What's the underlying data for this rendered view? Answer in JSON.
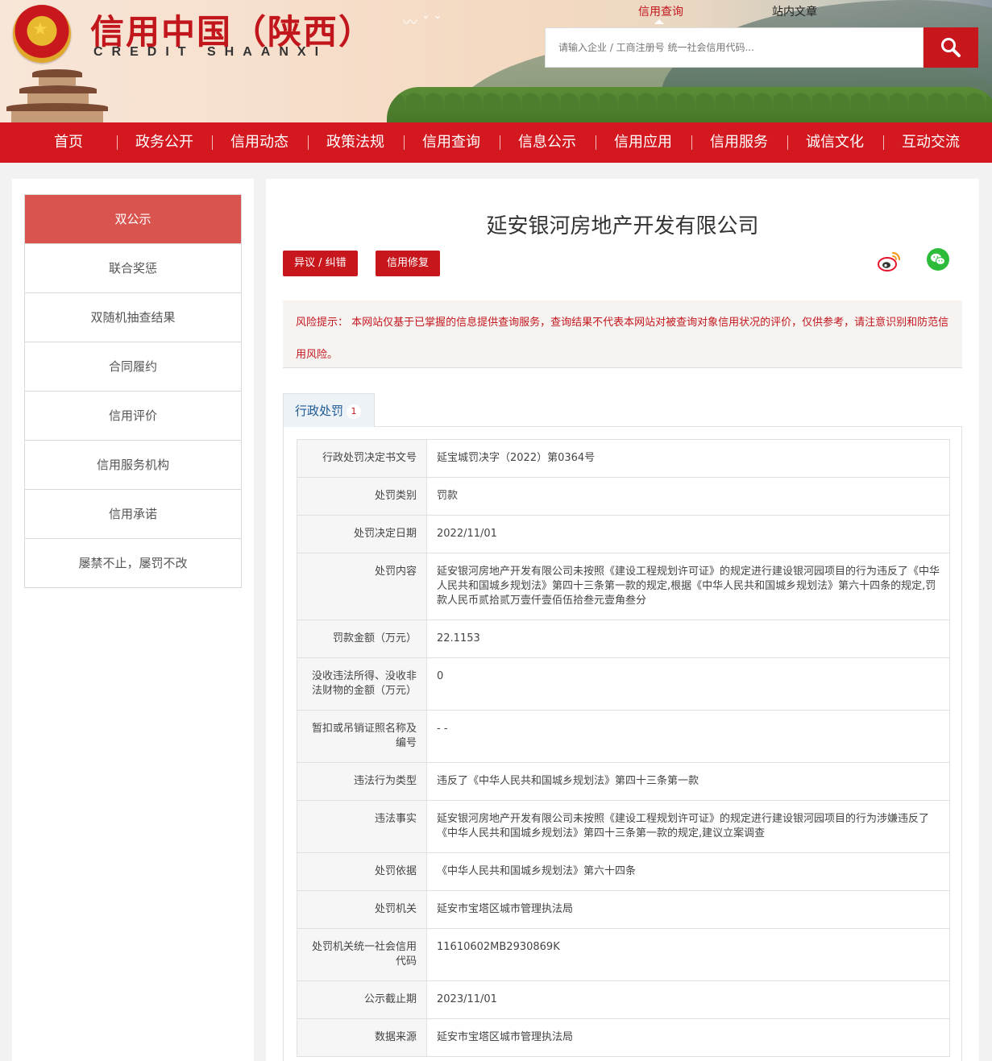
{
  "header": {
    "title": "信用中国（陕西）",
    "subtitle": "CREDIT   SHAANXI",
    "search_tabs": [
      "信用查询",
      "站内文章"
    ],
    "search_placeholder": "请输入企业 / 工商注册号 统一社会信用代码..."
  },
  "nav": [
    "首页",
    "政务公开",
    "信用动态",
    "政策法规",
    "信用查询",
    "信息公示",
    "信用应用",
    "信用服务",
    "诚信文化",
    "互动交流"
  ],
  "sidebar": [
    "双公示",
    "联合奖惩",
    "双随机抽查结果",
    "合同履约",
    "信用评价",
    "信用服务机构",
    "信用承诺",
    "屡禁不止，屡罚不改"
  ],
  "main": {
    "company": "延安银河房地产开发有限公司",
    "buttons": {
      "objection": "异议 / 纠错",
      "repair": "信用修复"
    },
    "risk_label": "风险提示：",
    "risk_text": "本网站仅基于已掌握的信息提供查询服务，查询结果不代表本网站对被查询对象信用状况的评价，仅供参考，请注意识别和防范信用风险。",
    "tab": {
      "label": "行政处罚",
      "count": "1"
    },
    "rows": [
      {
        "k": "行政处罚决定书文号",
        "v": "延宝城罚决字（2022）第0364号"
      },
      {
        "k": "处罚类别",
        "v": "罚款"
      },
      {
        "k": "处罚决定日期",
        "v": "2022/11/01"
      },
      {
        "k": "处罚内容",
        "v": "延安银河房地产开发有限公司未按照《建设工程规划许可证》的规定进行建设银河园项目的行为违反了《中华人民共和国城乡规划法》第四十三条第一款的规定,根据《中华人民共和国城乡规划法》第六十四条的规定,罚款人民币贰拾贰万壹仟壹佰伍拾叁元壹角叁分"
      },
      {
        "k": "罚款金额（万元）",
        "v": "22.1153"
      },
      {
        "k": "没收违法所得、没收非法财物的金额（万元）",
        "v": "0"
      },
      {
        "k": "暂扣或吊销证照名称及编号",
        "v": "- -"
      },
      {
        "k": "违法行为类型",
        "v": "违反了《中华人民共和国城乡规划法》第四十三条第一款"
      },
      {
        "k": "违法事实",
        "v": "延安银河房地产开发有限公司未按照《建设工程规划许可证》的规定进行建设银河园项目的行为涉嫌违反了《中华人民共和国城乡规划法》第四十三条第一款的规定,建议立案调查"
      },
      {
        "k": "处罚依据",
        "v": "《中华人民共和国城乡规划法》第六十四条"
      },
      {
        "k": "处罚机关",
        "v": "延安市宝塔区城市管理执法局"
      },
      {
        "k": "处罚机关统一社会信用代码",
        "v": "11610602MB2930869K"
      },
      {
        "k": "公示截止期",
        "v": "2023/11/01"
      },
      {
        "k": "数据来源",
        "v": "延安市宝塔区城市管理执法局"
      }
    ]
  }
}
